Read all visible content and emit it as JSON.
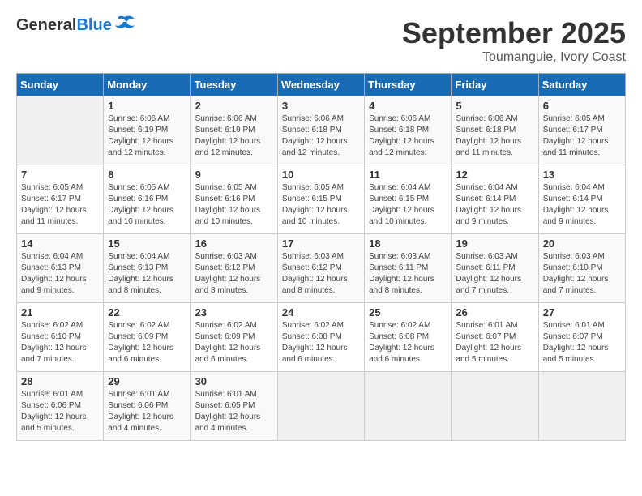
{
  "header": {
    "logo_general": "General",
    "logo_blue": "Blue",
    "month_title": "September 2025",
    "location": "Toumanguie, Ivory Coast"
  },
  "weekdays": [
    "Sunday",
    "Monday",
    "Tuesday",
    "Wednesday",
    "Thursday",
    "Friday",
    "Saturday"
  ],
  "weeks": [
    [
      {
        "day": "",
        "info": ""
      },
      {
        "day": "1",
        "info": "Sunrise: 6:06 AM\nSunset: 6:19 PM\nDaylight: 12 hours\nand 12 minutes."
      },
      {
        "day": "2",
        "info": "Sunrise: 6:06 AM\nSunset: 6:19 PM\nDaylight: 12 hours\nand 12 minutes."
      },
      {
        "day": "3",
        "info": "Sunrise: 6:06 AM\nSunset: 6:18 PM\nDaylight: 12 hours\nand 12 minutes."
      },
      {
        "day": "4",
        "info": "Sunrise: 6:06 AM\nSunset: 6:18 PM\nDaylight: 12 hours\nand 12 minutes."
      },
      {
        "day": "5",
        "info": "Sunrise: 6:06 AM\nSunset: 6:18 PM\nDaylight: 12 hours\nand 11 minutes."
      },
      {
        "day": "6",
        "info": "Sunrise: 6:05 AM\nSunset: 6:17 PM\nDaylight: 12 hours\nand 11 minutes."
      }
    ],
    [
      {
        "day": "7",
        "info": "Sunrise: 6:05 AM\nSunset: 6:17 PM\nDaylight: 12 hours\nand 11 minutes."
      },
      {
        "day": "8",
        "info": "Sunrise: 6:05 AM\nSunset: 6:16 PM\nDaylight: 12 hours\nand 10 minutes."
      },
      {
        "day": "9",
        "info": "Sunrise: 6:05 AM\nSunset: 6:16 PM\nDaylight: 12 hours\nand 10 minutes."
      },
      {
        "day": "10",
        "info": "Sunrise: 6:05 AM\nSunset: 6:15 PM\nDaylight: 12 hours\nand 10 minutes."
      },
      {
        "day": "11",
        "info": "Sunrise: 6:04 AM\nSunset: 6:15 PM\nDaylight: 12 hours\nand 10 minutes."
      },
      {
        "day": "12",
        "info": "Sunrise: 6:04 AM\nSunset: 6:14 PM\nDaylight: 12 hours\nand 9 minutes."
      },
      {
        "day": "13",
        "info": "Sunrise: 6:04 AM\nSunset: 6:14 PM\nDaylight: 12 hours\nand 9 minutes."
      }
    ],
    [
      {
        "day": "14",
        "info": "Sunrise: 6:04 AM\nSunset: 6:13 PM\nDaylight: 12 hours\nand 9 minutes."
      },
      {
        "day": "15",
        "info": "Sunrise: 6:04 AM\nSunset: 6:13 PM\nDaylight: 12 hours\nand 8 minutes."
      },
      {
        "day": "16",
        "info": "Sunrise: 6:03 AM\nSunset: 6:12 PM\nDaylight: 12 hours\nand 8 minutes."
      },
      {
        "day": "17",
        "info": "Sunrise: 6:03 AM\nSunset: 6:12 PM\nDaylight: 12 hours\nand 8 minutes."
      },
      {
        "day": "18",
        "info": "Sunrise: 6:03 AM\nSunset: 6:11 PM\nDaylight: 12 hours\nand 8 minutes."
      },
      {
        "day": "19",
        "info": "Sunrise: 6:03 AM\nSunset: 6:11 PM\nDaylight: 12 hours\nand 7 minutes."
      },
      {
        "day": "20",
        "info": "Sunrise: 6:03 AM\nSunset: 6:10 PM\nDaylight: 12 hours\nand 7 minutes."
      }
    ],
    [
      {
        "day": "21",
        "info": "Sunrise: 6:02 AM\nSunset: 6:10 PM\nDaylight: 12 hours\nand 7 minutes."
      },
      {
        "day": "22",
        "info": "Sunrise: 6:02 AM\nSunset: 6:09 PM\nDaylight: 12 hours\nand 6 minutes."
      },
      {
        "day": "23",
        "info": "Sunrise: 6:02 AM\nSunset: 6:09 PM\nDaylight: 12 hours\nand 6 minutes."
      },
      {
        "day": "24",
        "info": "Sunrise: 6:02 AM\nSunset: 6:08 PM\nDaylight: 12 hours\nand 6 minutes."
      },
      {
        "day": "25",
        "info": "Sunrise: 6:02 AM\nSunset: 6:08 PM\nDaylight: 12 hours\nand 6 minutes."
      },
      {
        "day": "26",
        "info": "Sunrise: 6:01 AM\nSunset: 6:07 PM\nDaylight: 12 hours\nand 5 minutes."
      },
      {
        "day": "27",
        "info": "Sunrise: 6:01 AM\nSunset: 6:07 PM\nDaylight: 12 hours\nand 5 minutes."
      }
    ],
    [
      {
        "day": "28",
        "info": "Sunrise: 6:01 AM\nSunset: 6:06 PM\nDaylight: 12 hours\nand 5 minutes."
      },
      {
        "day": "29",
        "info": "Sunrise: 6:01 AM\nSunset: 6:06 PM\nDaylight: 12 hours\nand 4 minutes."
      },
      {
        "day": "30",
        "info": "Sunrise: 6:01 AM\nSunset: 6:05 PM\nDaylight: 12 hours\nand 4 minutes."
      },
      {
        "day": "",
        "info": ""
      },
      {
        "day": "",
        "info": ""
      },
      {
        "day": "",
        "info": ""
      },
      {
        "day": "",
        "info": ""
      }
    ]
  ]
}
